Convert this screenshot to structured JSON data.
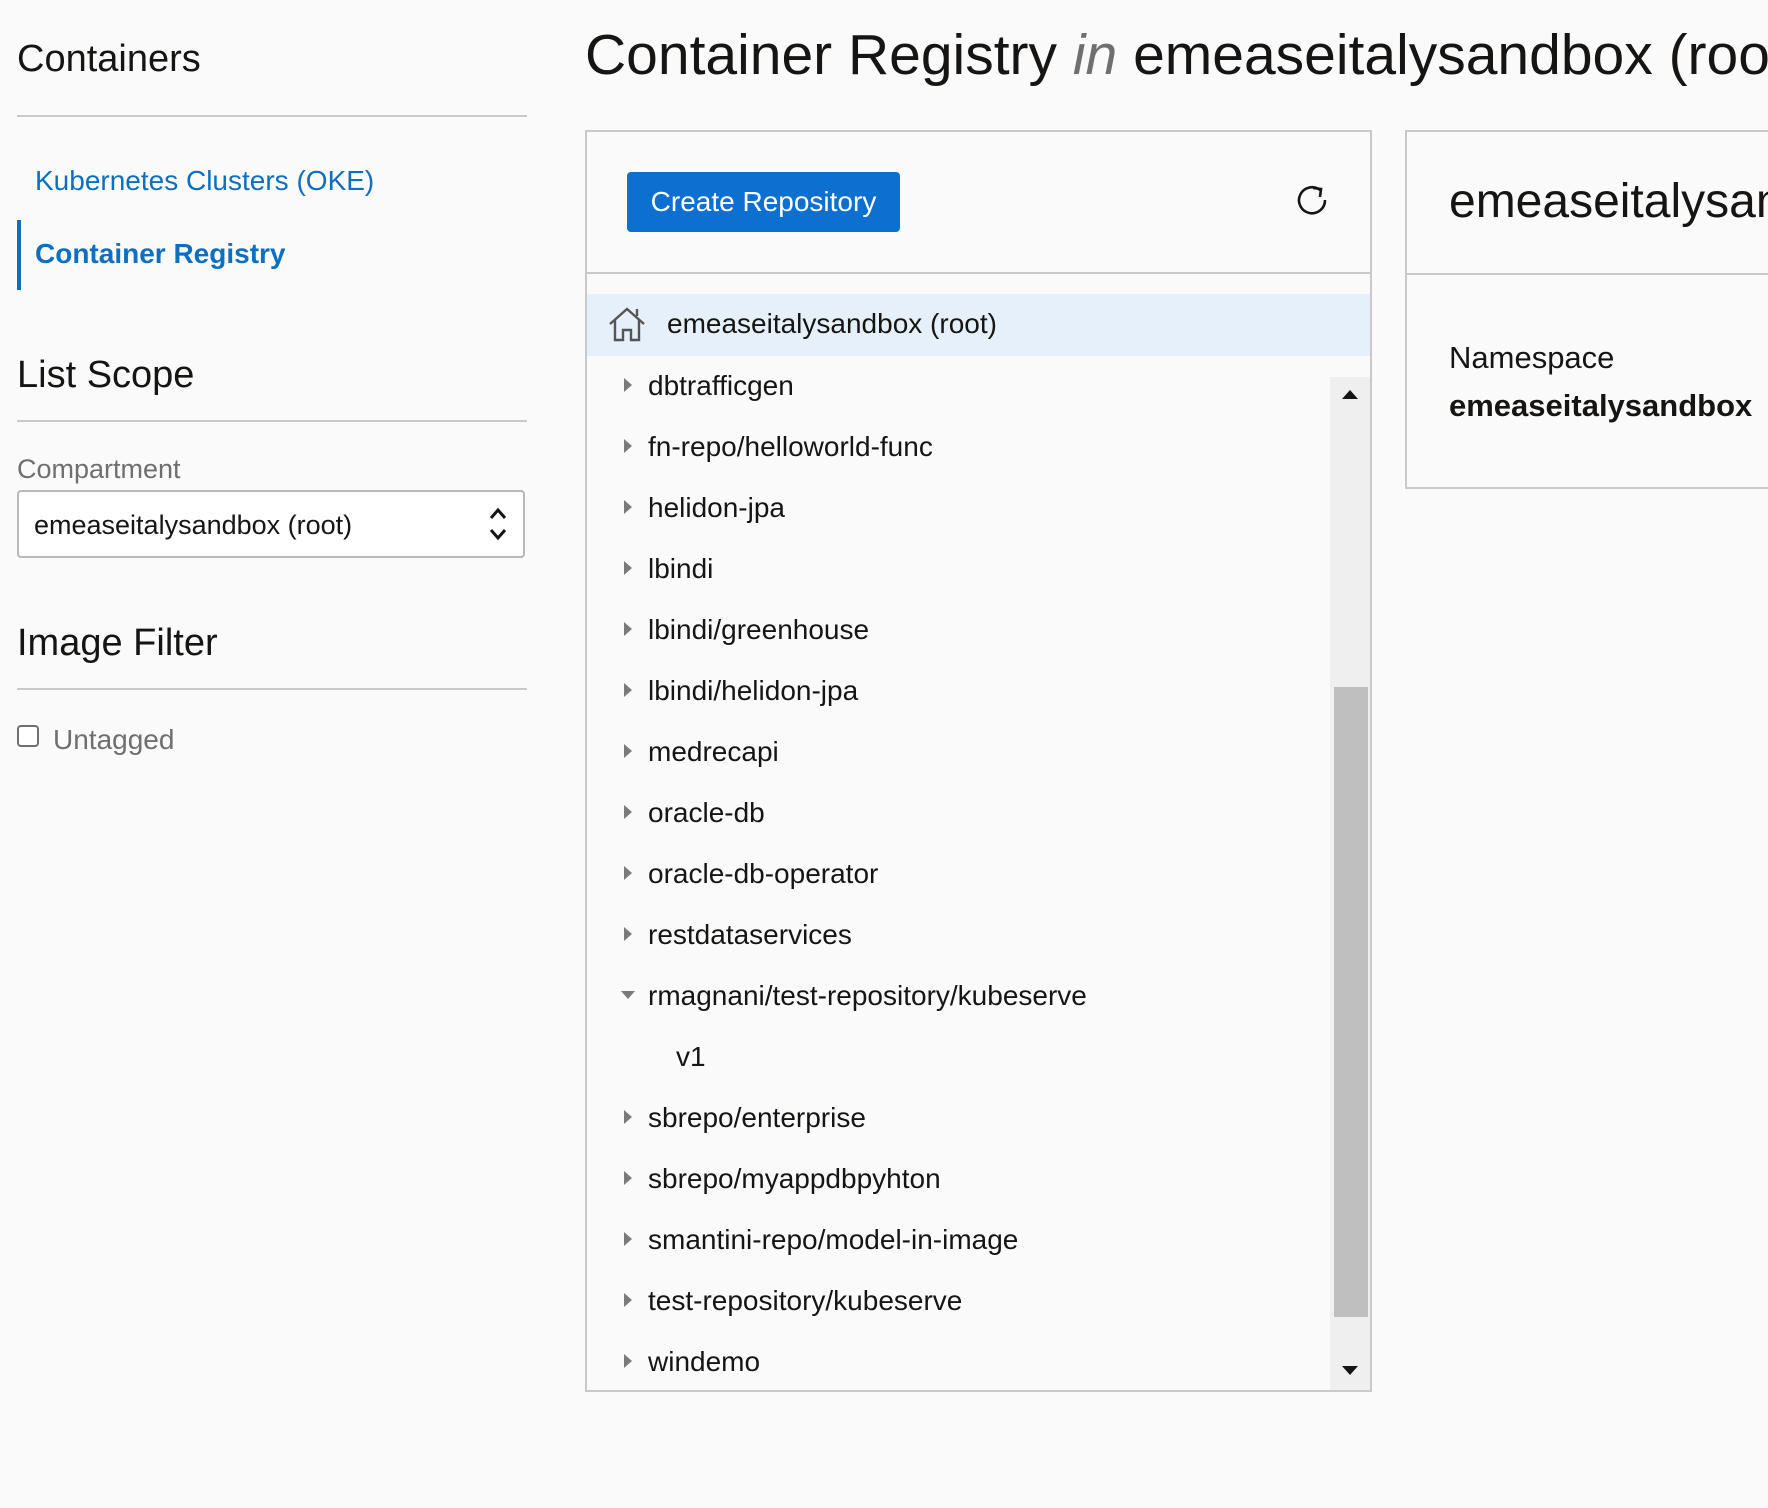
{
  "sidebar": {
    "title": "Containers",
    "nav": [
      {
        "label": "Kubernetes Clusters (OKE)",
        "active": false
      },
      {
        "label": "Container Registry",
        "active": true
      }
    ],
    "list_scope": {
      "heading": "List Scope",
      "compartment_label": "Compartment",
      "compartment_value": "emeaseitalysandbox (root)"
    },
    "image_filter": {
      "heading": "Image Filter",
      "untagged_label": "Untagged",
      "untagged_checked": false
    }
  },
  "header": {
    "title_prefix": "Container Registry ",
    "title_in": "in",
    "title_suffix": " emeaseitalysandbox (root)"
  },
  "toolbar": {
    "create_label": "Create Repository",
    "refresh_icon": "refresh-icon"
  },
  "tree": {
    "root": {
      "label": "emeaseitalysandbox (root)",
      "icon": "home-icon"
    },
    "items": [
      {
        "label": "dbtrafficgen",
        "expanded": false
      },
      {
        "label": "fn-repo/helloworld-func",
        "expanded": false
      },
      {
        "label": "helidon-jpa",
        "expanded": false
      },
      {
        "label": "lbindi",
        "expanded": false
      },
      {
        "label": "lbindi/greenhouse",
        "expanded": false
      },
      {
        "label": "lbindi/helidon-jpa",
        "expanded": false
      },
      {
        "label": "medrecapi",
        "expanded": false
      },
      {
        "label": "oracle-db",
        "expanded": false
      },
      {
        "label": "oracle-db-operator",
        "expanded": false
      },
      {
        "label": "restdataservices",
        "expanded": false
      },
      {
        "label": "rmagnani/test-repository/kubeserve",
        "expanded": true
      },
      {
        "label": "v1",
        "child": true
      },
      {
        "label": "sbrepo/enterprise",
        "expanded": false
      },
      {
        "label": "sbrepo/myappdbpyhton",
        "expanded": false
      },
      {
        "label": "smantini-repo/model-in-image",
        "expanded": false
      },
      {
        "label": "test-repository/kubeserve",
        "expanded": false
      },
      {
        "label": "windemo",
        "expanded": false
      }
    ]
  },
  "detail": {
    "title": "emeaseitalysandbox (root)",
    "namespace_label": "Namespace",
    "namespace_value": "emeaseitalysandbox"
  },
  "colors": {
    "accent": "#0d6fbf",
    "button": "#0d6fcf",
    "selected_row": "#e5f0fa"
  }
}
